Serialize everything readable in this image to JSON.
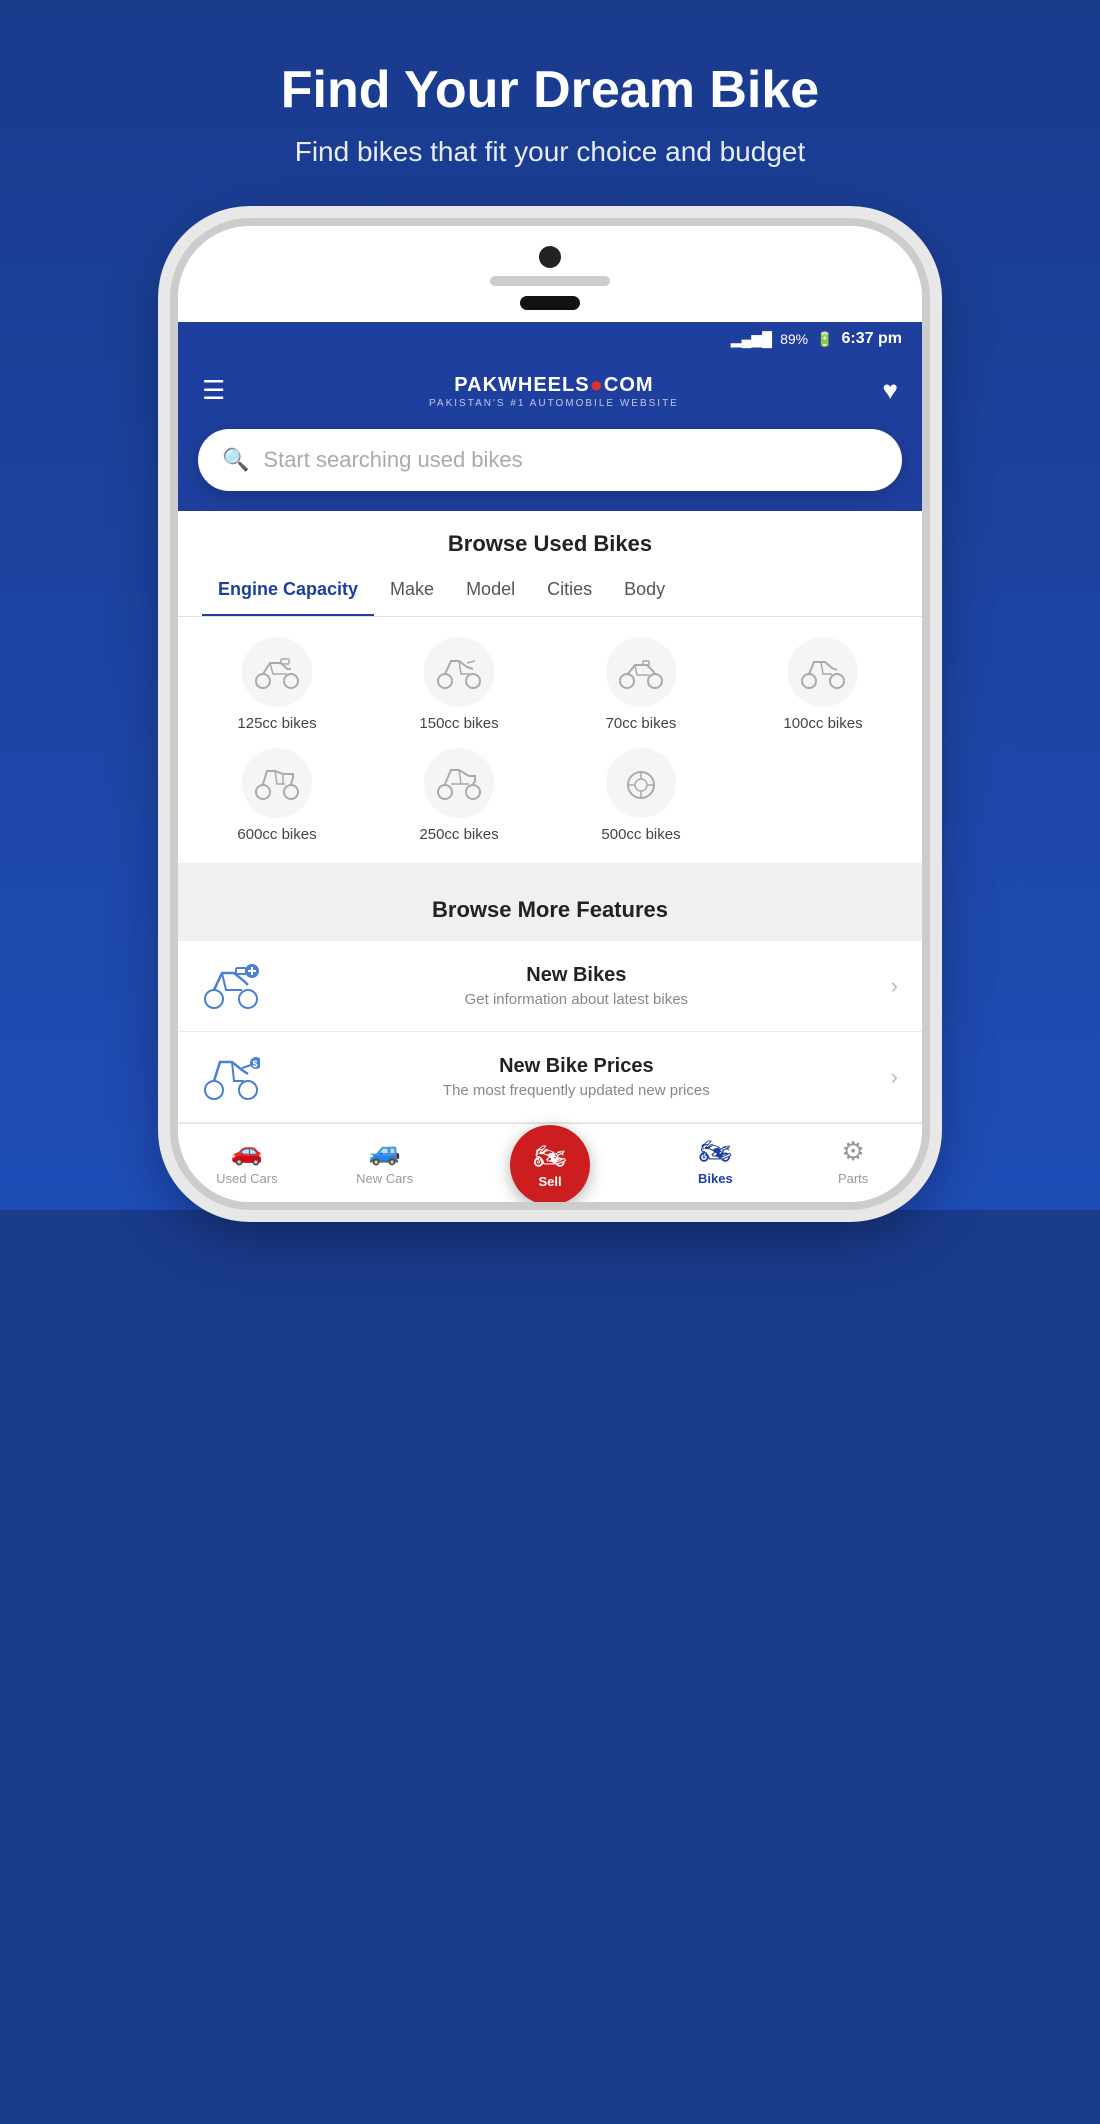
{
  "hero": {
    "title": "Find Your Dream Bike",
    "subtitle": "Find bikes that fit your choice and budget"
  },
  "statusBar": {
    "signal": "▂▄▆█",
    "battery": "89%",
    "time": "6:37 pm"
  },
  "header": {
    "logoText": "PAKWHEELS.COM",
    "tagline": "PAKISTAN'S #1 AUTOMOBILE WEBSITE"
  },
  "search": {
    "placeholder": "Start searching used bikes"
  },
  "browseSection": {
    "title": "Browse Used Bikes",
    "tabs": [
      {
        "label": "Engine Capacity",
        "active": true
      },
      {
        "label": "Make",
        "active": false
      },
      {
        "label": "Model",
        "active": false
      },
      {
        "label": "Cities",
        "active": false
      },
      {
        "label": "Body",
        "active": false
      }
    ],
    "bikes": [
      {
        "label": "125cc bikes",
        "icon": "🏍"
      },
      {
        "label": "150cc bikes",
        "icon": "🏍"
      },
      {
        "label": "70cc bikes",
        "icon": "🏍"
      },
      {
        "label": "100cc bikes",
        "icon": "🏍"
      },
      {
        "label": "600cc bikes",
        "icon": "🏍"
      },
      {
        "label": "250cc bikes",
        "icon": "🏍"
      },
      {
        "label": "500cc bikes",
        "icon": "🎯"
      }
    ]
  },
  "featuresSection": {
    "title": "Browse More Features",
    "items": [
      {
        "title": "New Bikes",
        "desc": "Get information about latest bikes",
        "icon": "🏍"
      },
      {
        "title": "New Bike Prices",
        "desc": "The most frequently updated new prices",
        "icon": "🏍"
      }
    ]
  },
  "bottomNav": {
    "items": [
      {
        "label": "Used Cars",
        "icon": "🚗",
        "active": false
      },
      {
        "label": "New Cars",
        "icon": "🚗",
        "active": false
      },
      {
        "label": "Sell",
        "icon": "🏍",
        "isSell": true
      },
      {
        "label": "Bikes",
        "icon": "🏍",
        "active": true
      },
      {
        "label": "Parts",
        "icon": "⚙",
        "active": false
      }
    ]
  }
}
